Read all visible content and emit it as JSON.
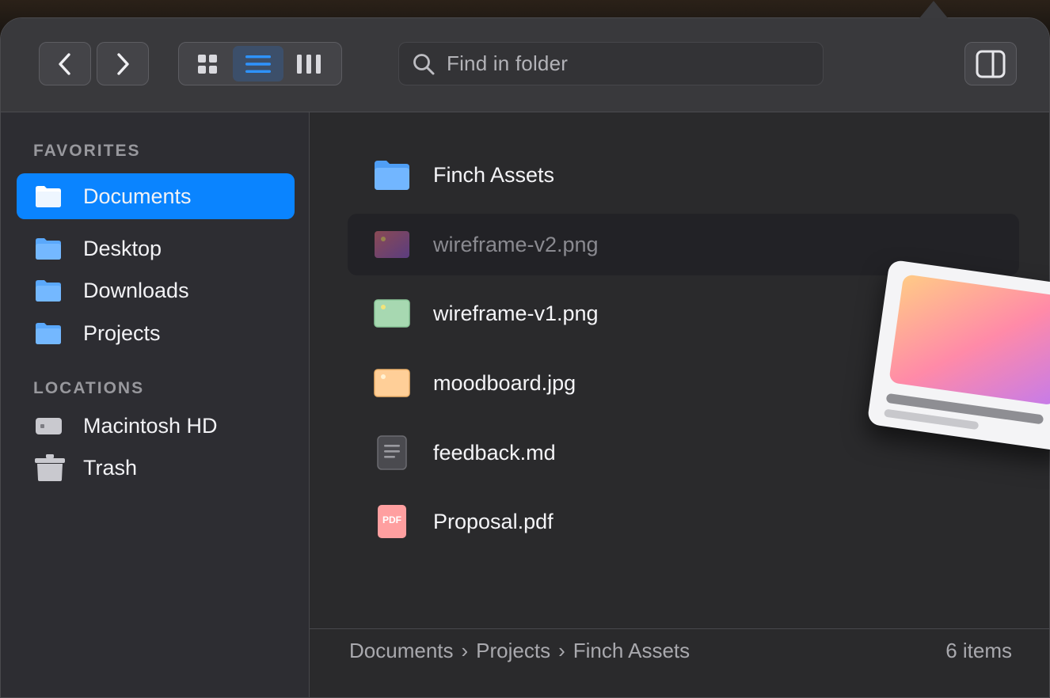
{
  "toolbar": {
    "back_icon": "chevron-left-icon",
    "forward_icon": "chevron-right-icon",
    "view_modes": [
      {
        "icon": "grid-view-icon",
        "active": false
      },
      {
        "icon": "list-view-icon",
        "active": true
      },
      {
        "icon": "column-view-icon",
        "active": false
      }
    ],
    "search_placeholder": "Find in folder",
    "sidebar_toggle_icon": "sidebar-toggle-icon"
  },
  "sidebar": {
    "favorites_title": "FAVORITES",
    "favorites": [
      {
        "label": "Documents",
        "icon": "folder-icon",
        "active": true
      },
      {
        "label": "Desktop",
        "icon": "folder-icon",
        "active": false
      },
      {
        "label": "Downloads",
        "icon": "folder-icon",
        "active": false
      },
      {
        "label": "Projects",
        "icon": "folder-icon",
        "active": false
      }
    ],
    "locations_title": "LOCATIONS",
    "locations": [
      {
        "label": "Macintosh HD",
        "icon": "hard-drive-icon"
      },
      {
        "label": "Trash",
        "icon": "trash-icon"
      }
    ]
  },
  "files": [
    {
      "name": "Finch Assets",
      "icon": "folder-icon",
      "state": "normal"
    },
    {
      "name": "wireframe-v2.png",
      "icon": "image-file-icon",
      "state": "dragging"
    },
    {
      "name": "wireframe-v1.png",
      "icon": "image-file-icon",
      "state": "normal"
    },
    {
      "name": "moodboard.jpg",
      "icon": "image-file-icon",
      "state": "normal"
    },
    {
      "name": "feedback.md",
      "icon": "text-file-icon",
      "state": "normal"
    },
    {
      "name": "Proposal.pdf",
      "icon": "pdf-file-icon",
      "state": "normal"
    }
  ],
  "pdf_badge": "PDF",
  "statusbar": {
    "breadcrumb": [
      "Documents",
      "Projects",
      "Finch Assets"
    ],
    "separator": "›",
    "item_count": "6 items"
  },
  "colors": {
    "accent": "#0a84ff",
    "folder": "#6fb6ff",
    "window_bg": "#2a2a2c",
    "sidebar_bg": "#2d2d32"
  }
}
